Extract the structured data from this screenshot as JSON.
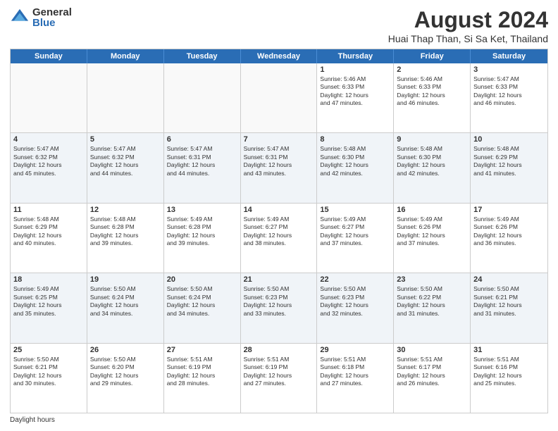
{
  "logo": {
    "general": "General",
    "blue": "Blue"
  },
  "title": "August 2024",
  "subtitle": "Huai Thap Than, Si Sa Ket, Thailand",
  "days_of_week": [
    "Sunday",
    "Monday",
    "Tuesday",
    "Wednesday",
    "Thursday",
    "Friday",
    "Saturday"
  ],
  "footer": "Daylight hours",
  "weeks": [
    [
      {
        "day": "",
        "info": ""
      },
      {
        "day": "",
        "info": ""
      },
      {
        "day": "",
        "info": ""
      },
      {
        "day": "",
        "info": ""
      },
      {
        "day": "1",
        "info": "Sunrise: 5:46 AM\nSunset: 6:33 PM\nDaylight: 12 hours\nand 47 minutes."
      },
      {
        "day": "2",
        "info": "Sunrise: 5:46 AM\nSunset: 6:33 PM\nDaylight: 12 hours\nand 46 minutes."
      },
      {
        "day": "3",
        "info": "Sunrise: 5:47 AM\nSunset: 6:33 PM\nDaylight: 12 hours\nand 46 minutes."
      }
    ],
    [
      {
        "day": "4",
        "info": "Sunrise: 5:47 AM\nSunset: 6:32 PM\nDaylight: 12 hours\nand 45 minutes."
      },
      {
        "day": "5",
        "info": "Sunrise: 5:47 AM\nSunset: 6:32 PM\nDaylight: 12 hours\nand 44 minutes."
      },
      {
        "day": "6",
        "info": "Sunrise: 5:47 AM\nSunset: 6:31 PM\nDaylight: 12 hours\nand 44 minutes."
      },
      {
        "day": "7",
        "info": "Sunrise: 5:47 AM\nSunset: 6:31 PM\nDaylight: 12 hours\nand 43 minutes."
      },
      {
        "day": "8",
        "info": "Sunrise: 5:48 AM\nSunset: 6:30 PM\nDaylight: 12 hours\nand 42 minutes."
      },
      {
        "day": "9",
        "info": "Sunrise: 5:48 AM\nSunset: 6:30 PM\nDaylight: 12 hours\nand 42 minutes."
      },
      {
        "day": "10",
        "info": "Sunrise: 5:48 AM\nSunset: 6:29 PM\nDaylight: 12 hours\nand 41 minutes."
      }
    ],
    [
      {
        "day": "11",
        "info": "Sunrise: 5:48 AM\nSunset: 6:29 PM\nDaylight: 12 hours\nand 40 minutes."
      },
      {
        "day": "12",
        "info": "Sunrise: 5:48 AM\nSunset: 6:28 PM\nDaylight: 12 hours\nand 39 minutes."
      },
      {
        "day": "13",
        "info": "Sunrise: 5:49 AM\nSunset: 6:28 PM\nDaylight: 12 hours\nand 39 minutes."
      },
      {
        "day": "14",
        "info": "Sunrise: 5:49 AM\nSunset: 6:27 PM\nDaylight: 12 hours\nand 38 minutes."
      },
      {
        "day": "15",
        "info": "Sunrise: 5:49 AM\nSunset: 6:27 PM\nDaylight: 12 hours\nand 37 minutes."
      },
      {
        "day": "16",
        "info": "Sunrise: 5:49 AM\nSunset: 6:26 PM\nDaylight: 12 hours\nand 37 minutes."
      },
      {
        "day": "17",
        "info": "Sunrise: 5:49 AM\nSunset: 6:26 PM\nDaylight: 12 hours\nand 36 minutes."
      }
    ],
    [
      {
        "day": "18",
        "info": "Sunrise: 5:49 AM\nSunset: 6:25 PM\nDaylight: 12 hours\nand 35 minutes."
      },
      {
        "day": "19",
        "info": "Sunrise: 5:50 AM\nSunset: 6:24 PM\nDaylight: 12 hours\nand 34 minutes."
      },
      {
        "day": "20",
        "info": "Sunrise: 5:50 AM\nSunset: 6:24 PM\nDaylight: 12 hours\nand 34 minutes."
      },
      {
        "day": "21",
        "info": "Sunrise: 5:50 AM\nSunset: 6:23 PM\nDaylight: 12 hours\nand 33 minutes."
      },
      {
        "day": "22",
        "info": "Sunrise: 5:50 AM\nSunset: 6:23 PM\nDaylight: 12 hours\nand 32 minutes."
      },
      {
        "day": "23",
        "info": "Sunrise: 5:50 AM\nSunset: 6:22 PM\nDaylight: 12 hours\nand 31 minutes."
      },
      {
        "day": "24",
        "info": "Sunrise: 5:50 AM\nSunset: 6:21 PM\nDaylight: 12 hours\nand 31 minutes."
      }
    ],
    [
      {
        "day": "25",
        "info": "Sunrise: 5:50 AM\nSunset: 6:21 PM\nDaylight: 12 hours\nand 30 minutes."
      },
      {
        "day": "26",
        "info": "Sunrise: 5:50 AM\nSunset: 6:20 PM\nDaylight: 12 hours\nand 29 minutes."
      },
      {
        "day": "27",
        "info": "Sunrise: 5:51 AM\nSunset: 6:19 PM\nDaylight: 12 hours\nand 28 minutes."
      },
      {
        "day": "28",
        "info": "Sunrise: 5:51 AM\nSunset: 6:19 PM\nDaylight: 12 hours\nand 27 minutes."
      },
      {
        "day": "29",
        "info": "Sunrise: 5:51 AM\nSunset: 6:18 PM\nDaylight: 12 hours\nand 27 minutes."
      },
      {
        "day": "30",
        "info": "Sunrise: 5:51 AM\nSunset: 6:17 PM\nDaylight: 12 hours\nand 26 minutes."
      },
      {
        "day": "31",
        "info": "Sunrise: 5:51 AM\nSunset: 6:16 PM\nDaylight: 12 hours\nand 25 minutes."
      }
    ]
  ]
}
